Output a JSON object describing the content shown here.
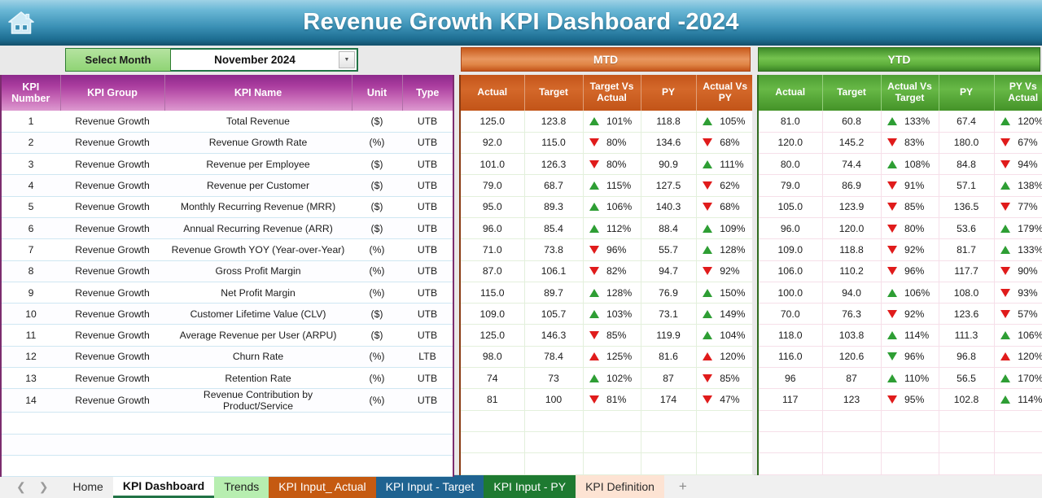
{
  "header": {
    "title": "Revenue Growth KPI Dashboard -2024",
    "home_icon": "home-icon",
    "gradient_from": "#9ed2e6",
    "gradient_to": "#16536f"
  },
  "controls": {
    "select_month_label": "Select Month",
    "selected_month": "November 2024",
    "dropdown_icon": "chevron-down-icon",
    "mtd_label": "MTD",
    "ytd_label": "YTD",
    "mtd_color": "#c4551a",
    "ytd_color": "#4d9e33"
  },
  "kpi_table": {
    "headers": [
      "KPI Number",
      "KPI Group",
      "KPI Name",
      "Unit",
      "Type"
    ],
    "header_color": "#a93c9e",
    "rows": [
      {
        "num": "1",
        "group": "Revenue Growth",
        "name": "Total Revenue",
        "unit": "($)",
        "type": "UTB"
      },
      {
        "num": "2",
        "group": "Revenue Growth",
        "name": "Revenue Growth Rate",
        "unit": "(%)",
        "type": "UTB"
      },
      {
        "num": "3",
        "group": "Revenue Growth",
        "name": "Revenue per Employee",
        "unit": "($)",
        "type": "UTB"
      },
      {
        "num": "4",
        "group": "Revenue Growth",
        "name": "Revenue per Customer",
        "unit": "($)",
        "type": "UTB"
      },
      {
        "num": "5",
        "group": "Revenue Growth",
        "name": "Monthly Recurring Revenue (MRR)",
        "unit": "($)",
        "type": "UTB"
      },
      {
        "num": "6",
        "group": "Revenue Growth",
        "name": "Annual Recurring Revenue (ARR)",
        "unit": "($)",
        "type": "UTB"
      },
      {
        "num": "7",
        "group": "Revenue Growth",
        "name": "Revenue Growth YOY (Year-over-Year)",
        "unit": "(%)",
        "type": "UTB"
      },
      {
        "num": "8",
        "group": "Revenue Growth",
        "name": "Gross Profit Margin",
        "unit": "(%)",
        "type": "UTB"
      },
      {
        "num": "9",
        "group": "Revenue Growth",
        "name": "Net Profit Margin",
        "unit": "(%)",
        "type": "UTB"
      },
      {
        "num": "10",
        "group": "Revenue Growth",
        "name": "Customer Lifetime Value (CLV)",
        "unit": "($)",
        "type": "UTB"
      },
      {
        "num": "11",
        "group": "Revenue Growth",
        "name": "Average Revenue per User (ARPU)",
        "unit": "($)",
        "type": "UTB"
      },
      {
        "num": "12",
        "group": "Revenue Growth",
        "name": "Churn Rate",
        "unit": "(%)",
        "type": "LTB"
      },
      {
        "num": "13",
        "group": "Revenue Growth",
        "name": "Retention Rate",
        "unit": "(%)",
        "type": "UTB"
      },
      {
        "num": "14",
        "group": "Revenue Growth",
        "name": "Revenue Contribution by Product/Service",
        "unit": "(%)",
        "type": "UTB"
      }
    ]
  },
  "mtd_table": {
    "headers": [
      "Actual",
      "Target",
      "Target Vs Actual",
      "PY",
      "Actual Vs PY"
    ],
    "rows": [
      {
        "actual": "125.0",
        "target": "123.8",
        "cmp1": {
          "dir": "up",
          "color": "g",
          "pct": "101%"
        },
        "py": "118.8",
        "cmp2": {
          "dir": "up",
          "color": "g",
          "pct": "105%"
        }
      },
      {
        "actual": "92.0",
        "target": "115.0",
        "cmp1": {
          "dir": "down",
          "color": "r",
          "pct": "80%"
        },
        "py": "134.6",
        "cmp2": {
          "dir": "down",
          "color": "r",
          "pct": "68%"
        }
      },
      {
        "actual": "101.0",
        "target": "126.3",
        "cmp1": {
          "dir": "down",
          "color": "r",
          "pct": "80%"
        },
        "py": "90.9",
        "cmp2": {
          "dir": "up",
          "color": "g",
          "pct": "111%"
        }
      },
      {
        "actual": "79.0",
        "target": "68.7",
        "cmp1": {
          "dir": "up",
          "color": "g",
          "pct": "115%"
        },
        "py": "127.5",
        "cmp2": {
          "dir": "down",
          "color": "r",
          "pct": "62%"
        }
      },
      {
        "actual": "95.0",
        "target": "89.3",
        "cmp1": {
          "dir": "up",
          "color": "g",
          "pct": "106%"
        },
        "py": "140.3",
        "cmp2": {
          "dir": "down",
          "color": "r",
          "pct": "68%"
        }
      },
      {
        "actual": "96.0",
        "target": "85.4",
        "cmp1": {
          "dir": "up",
          "color": "g",
          "pct": "112%"
        },
        "py": "88.4",
        "cmp2": {
          "dir": "up",
          "color": "g",
          "pct": "109%"
        }
      },
      {
        "actual": "71.0",
        "target": "73.8",
        "cmp1": {
          "dir": "down",
          "color": "r",
          "pct": "96%"
        },
        "py": "55.7",
        "cmp2": {
          "dir": "up",
          "color": "g",
          "pct": "128%"
        }
      },
      {
        "actual": "87.0",
        "target": "106.1",
        "cmp1": {
          "dir": "down",
          "color": "r",
          "pct": "82%"
        },
        "py": "94.7",
        "cmp2": {
          "dir": "down",
          "color": "r",
          "pct": "92%"
        }
      },
      {
        "actual": "115.0",
        "target": "89.7",
        "cmp1": {
          "dir": "up",
          "color": "g",
          "pct": "128%"
        },
        "py": "76.9",
        "cmp2": {
          "dir": "up",
          "color": "g",
          "pct": "150%"
        }
      },
      {
        "actual": "109.0",
        "target": "105.7",
        "cmp1": {
          "dir": "up",
          "color": "g",
          "pct": "103%"
        },
        "py": "73.1",
        "cmp2": {
          "dir": "up",
          "color": "g",
          "pct": "149%"
        }
      },
      {
        "actual": "125.0",
        "target": "146.3",
        "cmp1": {
          "dir": "down",
          "color": "r",
          "pct": "85%"
        },
        "py": "119.9",
        "cmp2": {
          "dir": "up",
          "color": "g",
          "pct": "104%"
        }
      },
      {
        "actual": "98.0",
        "target": "78.4",
        "cmp1": {
          "dir": "up",
          "color": "r",
          "pct": "125%"
        },
        "py": "81.6",
        "cmp2": {
          "dir": "up",
          "color": "r",
          "pct": "120%"
        }
      },
      {
        "actual": "74",
        "target": "73",
        "cmp1": {
          "dir": "up",
          "color": "g",
          "pct": "102%"
        },
        "py": "87",
        "cmp2": {
          "dir": "down",
          "color": "r",
          "pct": "85%"
        }
      },
      {
        "actual": "81",
        "target": "100",
        "cmp1": {
          "dir": "down",
          "color": "r",
          "pct": "81%"
        },
        "py": "174",
        "cmp2": {
          "dir": "down",
          "color": "r",
          "pct": "47%"
        }
      }
    ]
  },
  "ytd_table": {
    "headers": [
      "Actual",
      "Target",
      "Actual Vs Target",
      "PY",
      "PY Vs Actual"
    ],
    "rows": [
      {
        "actual": "81.0",
        "target": "60.8",
        "cmp1": {
          "dir": "up",
          "color": "g",
          "pct": "133%"
        },
        "py": "67.4",
        "cmp2": {
          "dir": "up",
          "color": "g",
          "pct": "120%"
        }
      },
      {
        "actual": "120.0",
        "target": "145.2",
        "cmp1": {
          "dir": "down",
          "color": "r",
          "pct": "83%"
        },
        "py": "180.0",
        "cmp2": {
          "dir": "down",
          "color": "r",
          "pct": "67%"
        }
      },
      {
        "actual": "80.0",
        "target": "74.4",
        "cmp1": {
          "dir": "up",
          "color": "g",
          "pct": "108%"
        },
        "py": "84.8",
        "cmp2": {
          "dir": "down",
          "color": "r",
          "pct": "94%"
        }
      },
      {
        "actual": "79.0",
        "target": "86.9",
        "cmp1": {
          "dir": "down",
          "color": "r",
          "pct": "91%"
        },
        "py": "57.1",
        "cmp2": {
          "dir": "up",
          "color": "g",
          "pct": "138%"
        }
      },
      {
        "actual": "105.0",
        "target": "123.9",
        "cmp1": {
          "dir": "down",
          "color": "r",
          "pct": "85%"
        },
        "py": "136.5",
        "cmp2": {
          "dir": "down",
          "color": "r",
          "pct": "77%"
        }
      },
      {
        "actual": "96.0",
        "target": "120.0",
        "cmp1": {
          "dir": "down",
          "color": "r",
          "pct": "80%"
        },
        "py": "53.6",
        "cmp2": {
          "dir": "up",
          "color": "g",
          "pct": "179%"
        }
      },
      {
        "actual": "109.0",
        "target": "118.8",
        "cmp1": {
          "dir": "down",
          "color": "r",
          "pct": "92%"
        },
        "py": "81.7",
        "cmp2": {
          "dir": "up",
          "color": "g",
          "pct": "133%"
        }
      },
      {
        "actual": "106.0",
        "target": "110.2",
        "cmp1": {
          "dir": "down",
          "color": "r",
          "pct": "96%"
        },
        "py": "117.7",
        "cmp2": {
          "dir": "down",
          "color": "r",
          "pct": "90%"
        }
      },
      {
        "actual": "100.0",
        "target": "94.0",
        "cmp1": {
          "dir": "up",
          "color": "g",
          "pct": "106%"
        },
        "py": "108.0",
        "cmp2": {
          "dir": "down",
          "color": "r",
          "pct": "93%"
        }
      },
      {
        "actual": "70.0",
        "target": "76.3",
        "cmp1": {
          "dir": "down",
          "color": "r",
          "pct": "92%"
        },
        "py": "123.6",
        "cmp2": {
          "dir": "down",
          "color": "r",
          "pct": "57%"
        }
      },
      {
        "actual": "118.0",
        "target": "103.8",
        "cmp1": {
          "dir": "up",
          "color": "g",
          "pct": "114%"
        },
        "py": "111.3",
        "cmp2": {
          "dir": "up",
          "color": "g",
          "pct": "106%"
        }
      },
      {
        "actual": "116.0",
        "target": "120.6",
        "cmp1": {
          "dir": "down",
          "color": "g",
          "pct": "96%"
        },
        "py": "96.8",
        "cmp2": {
          "dir": "up",
          "color": "r",
          "pct": "120%"
        }
      },
      {
        "actual": "96",
        "target": "87",
        "cmp1": {
          "dir": "up",
          "color": "g",
          "pct": "110%"
        },
        "py": "56.5",
        "cmp2": {
          "dir": "up",
          "color": "g",
          "pct": "170%"
        }
      },
      {
        "actual": "117",
        "target": "123",
        "cmp1": {
          "dir": "down",
          "color": "r",
          "pct": "95%"
        },
        "py": "102.8",
        "cmp2": {
          "dir": "up",
          "color": "g",
          "pct": "114%"
        }
      }
    ]
  },
  "empty_rows": 3,
  "sheet_tabs": {
    "prev_icon": "chevron-left-icon",
    "next_icon": "chevron-right-icon",
    "add_icon": "plus-icon",
    "items": [
      {
        "label": "Home",
        "style": "plain"
      },
      {
        "label": "KPI Dashboard",
        "style": "active"
      },
      {
        "label": "Trends",
        "style": "green-lt"
      },
      {
        "label": "KPI Input_ Actual",
        "style": "orange"
      },
      {
        "label": "KPI Input - Target",
        "style": "blue"
      },
      {
        "label": "KPI Input - PY",
        "style": "green-dk"
      },
      {
        "label": "KPI Definition",
        "style": "peach"
      }
    ]
  }
}
